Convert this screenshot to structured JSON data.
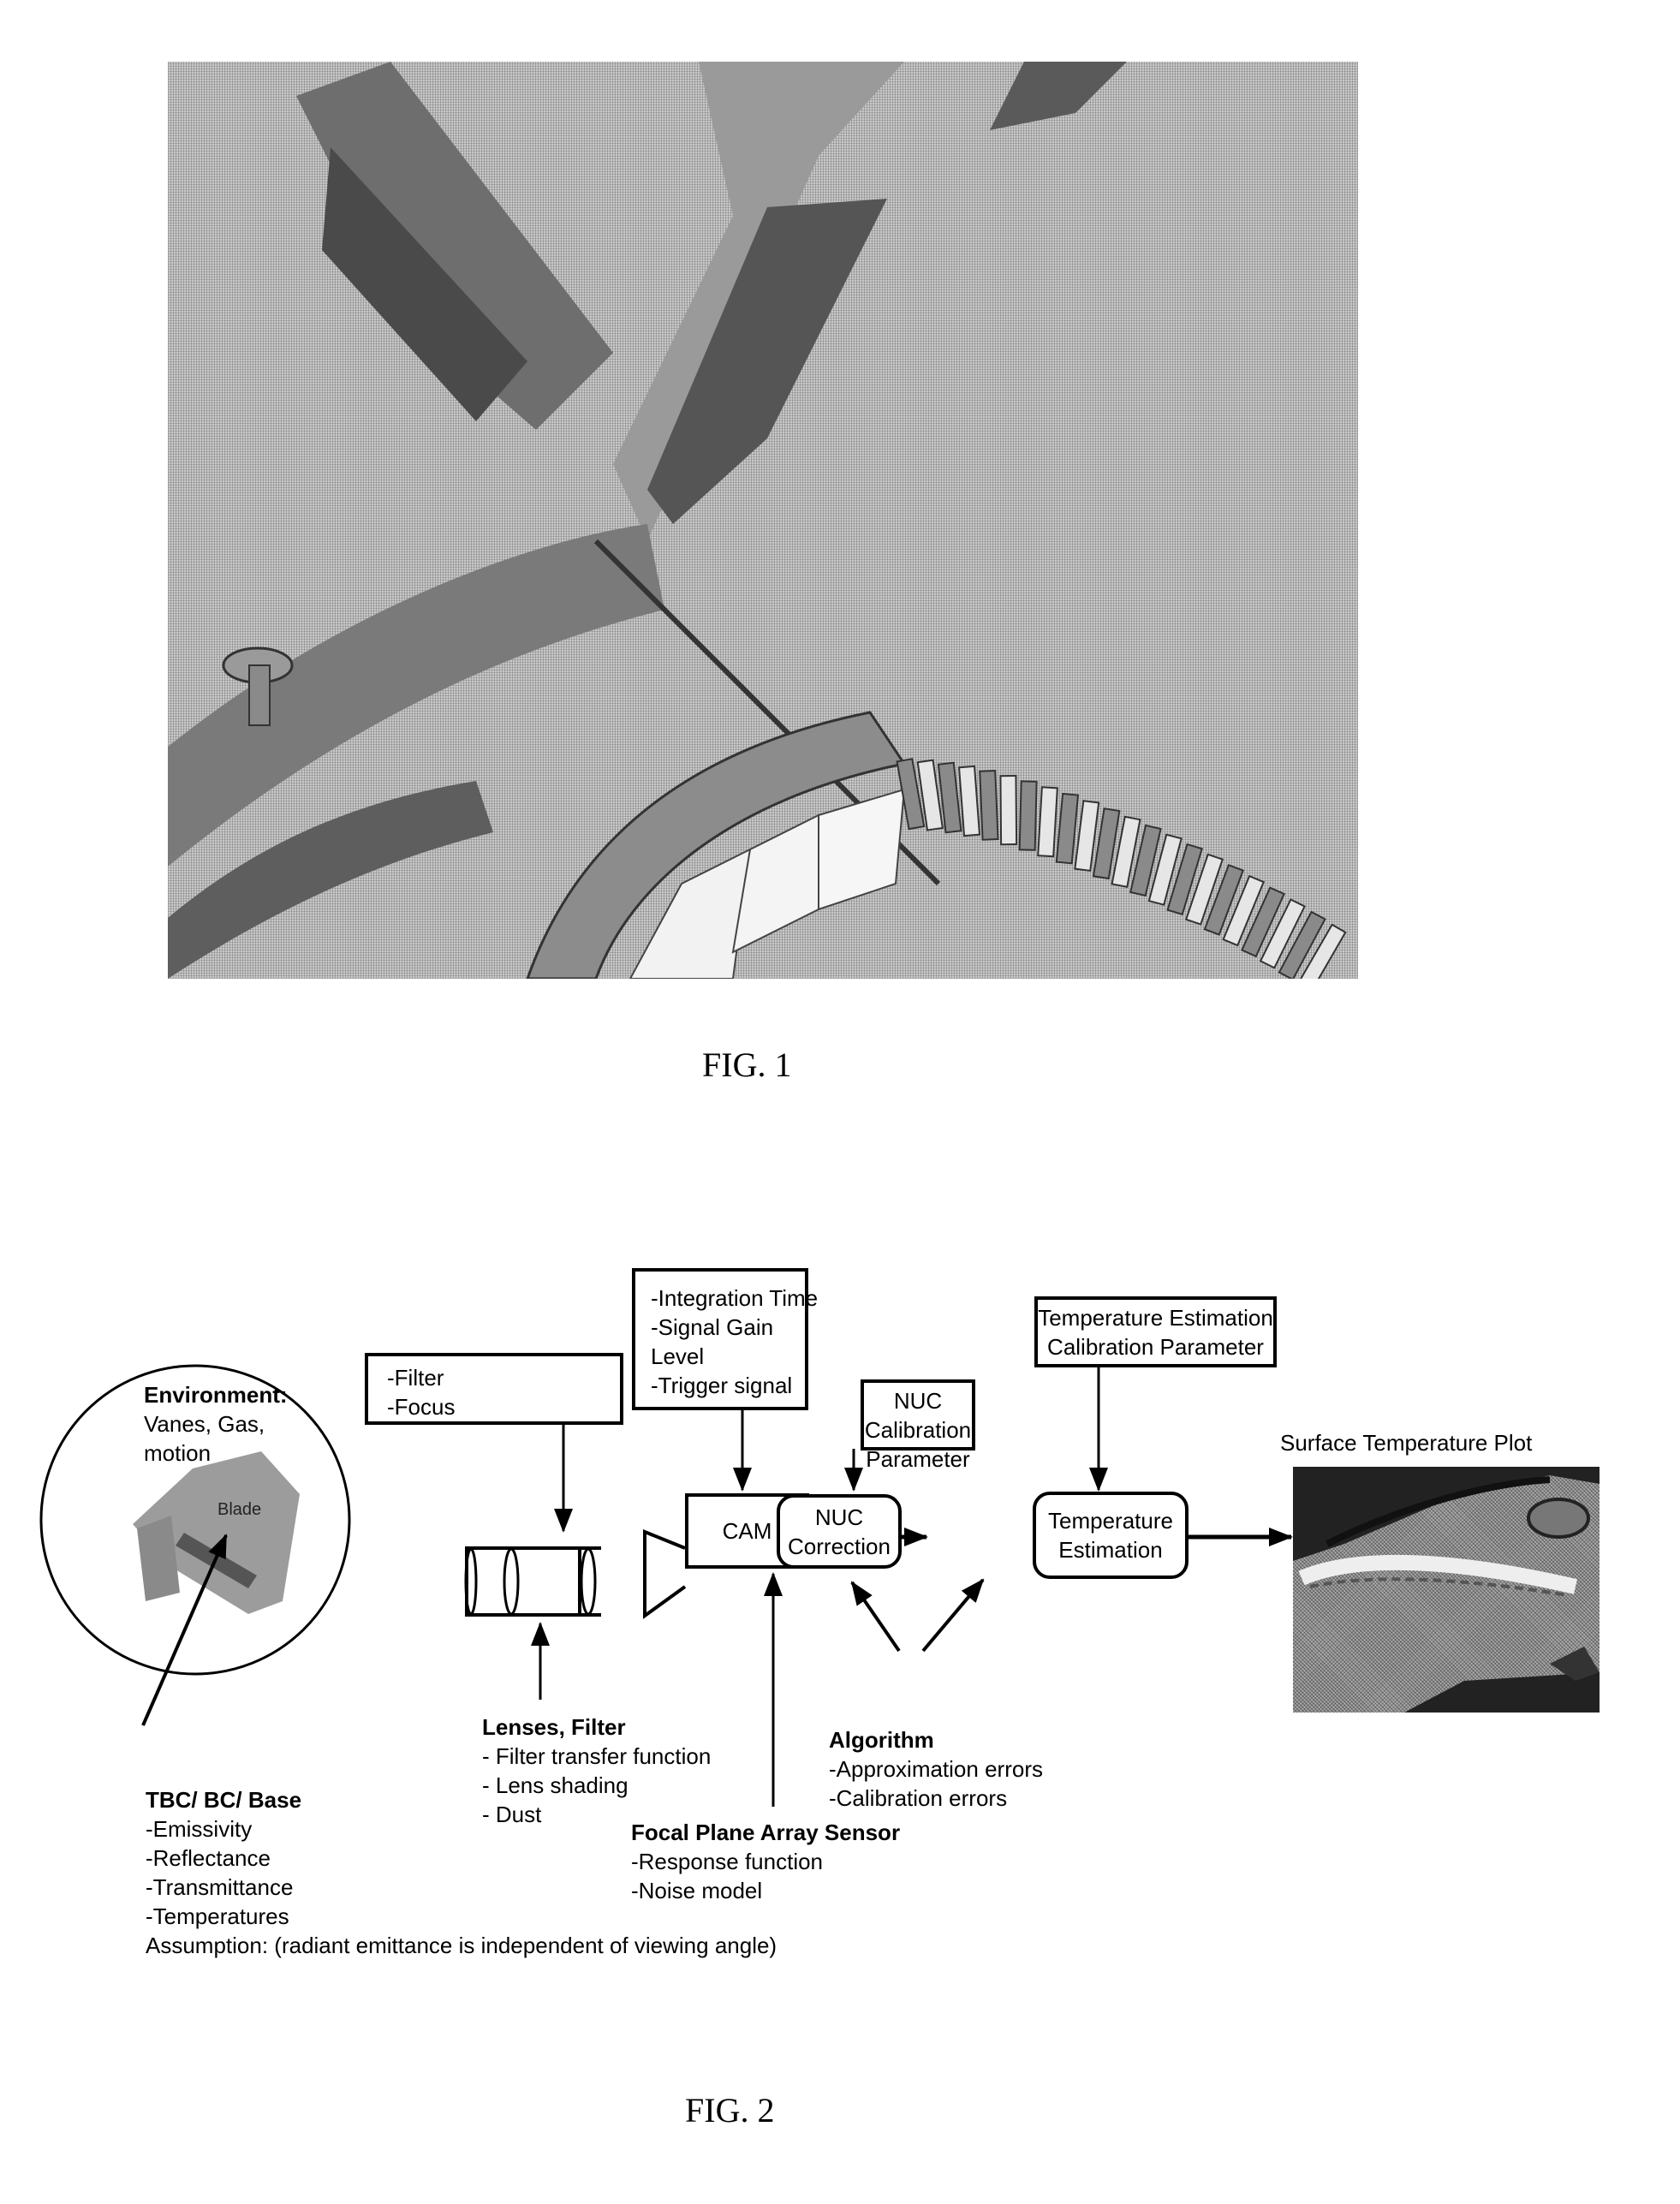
{
  "fig1": {
    "caption": "FIG. 1",
    "image_description": "photograph of gas turbine combustor section with inserted optical probe viewing a row of turbine blades"
  },
  "fig2": {
    "caption": "FIG. 2",
    "environment": {
      "title": "Environment:",
      "lines": [
        "Vanes, Gas,",
        "motion"
      ],
      "blade_label": "Blade"
    },
    "tbc": {
      "title": "TBC/ BC/ Base",
      "lines": [
        "-Emissivity",
        "-Reflectance",
        "-Transmittance",
        "-Temperatures"
      ],
      "assumption": "Assumption: (radiant emittance is independent of viewing angle)"
    },
    "filter_focus_box": {
      "lines": [
        "-Filter",
        "-Focus"
      ]
    },
    "lenses": {
      "title": "Lenses, Filter",
      "lines": [
        "- Filter transfer function",
        "- Lens shading",
        "- Dust"
      ]
    },
    "camera_settings_box": {
      "lines": [
        "-Integration Time",
        "-Signal Gain",
        "Level",
        "-Trigger signal"
      ]
    },
    "cam_label": "CAM",
    "fpa": {
      "title": "Focal Plane Array Sensor",
      "lines": [
        "-Response function",
        "-Noise model"
      ]
    },
    "nuc_calibration_box": {
      "lines": [
        "NUC",
        "Calibration",
        "Parameter"
      ]
    },
    "nuc_correction_box": {
      "lines": [
        "NUC",
        "Correction"
      ]
    },
    "temp_cal_box": {
      "lines": [
        "Temperature Estimation",
        "Calibration Parameter"
      ]
    },
    "temp_estimation_box": {
      "lines": [
        "Temperature",
        "Estimation"
      ]
    },
    "algorithm": {
      "title": "Algorithm",
      "lines": [
        "-Approximation errors",
        "-Calibration errors"
      ]
    },
    "surface_plot_label": "Surface Temperature Plot"
  }
}
